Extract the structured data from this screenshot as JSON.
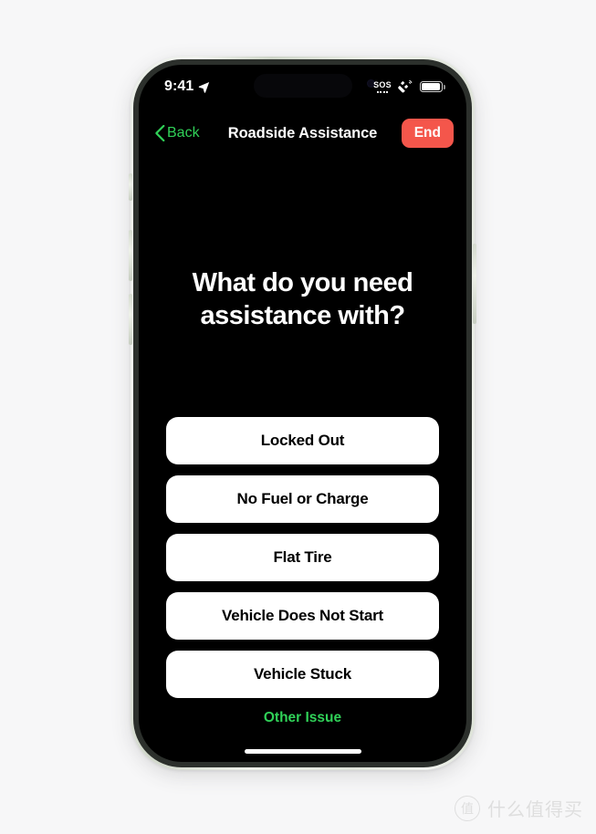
{
  "status_bar": {
    "time": "9:41",
    "location_icon": "location-arrow-icon",
    "sos_label": "SOS",
    "satellite_icon": "satellite-icon",
    "battery_icon": "battery-icon"
  },
  "nav_bar": {
    "back_label": "Back",
    "title": "Roadside Assistance",
    "end_label": "End",
    "accent_green": "#30d158",
    "end_red": "#f4564b"
  },
  "main": {
    "heading": "What do you need assistance with?",
    "options": [
      {
        "label": "Locked Out"
      },
      {
        "label": "No Fuel or Charge"
      },
      {
        "label": "Flat Tire"
      },
      {
        "label": "Vehicle Does Not Start"
      },
      {
        "label": "Vehicle Stuck"
      }
    ],
    "other_issue_label": "Other Issue"
  },
  "watermark": {
    "badge": "值",
    "text": "什么值得买"
  }
}
